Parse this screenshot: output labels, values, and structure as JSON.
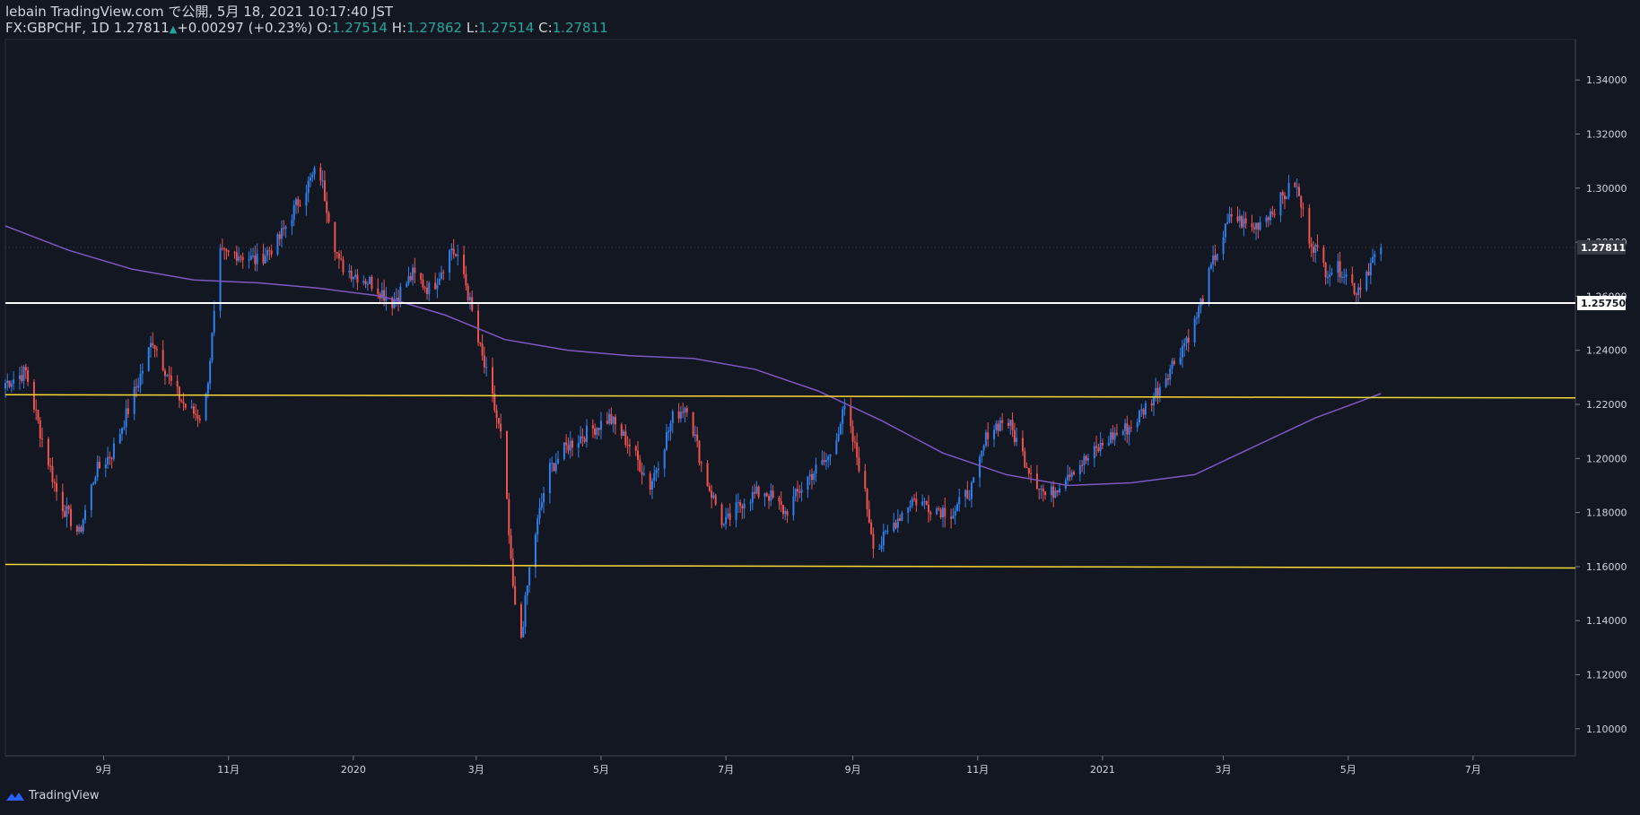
{
  "header": {
    "line1": "lebain TradingView.com で公開, 5月 18, 2021 10:17:40 JST",
    "symbol": "FX:GBPCHF, 1D",
    "last": "1.27811",
    "change": "+0.00297 (+0.23%)",
    "o_label": "O:",
    "o_value": "1.27514",
    "h_label": "H:",
    "h_value": "1.27862",
    "l_label": "L:",
    "l_value": "1.27514",
    "c_label": "C:",
    "c_value": "1.27811"
  },
  "footer": {
    "brand": "TradingView"
  },
  "colors": {
    "background": "#131722",
    "up": "#2f80ed",
    "down": "#ef5350",
    "ma": "#7e57c2",
    "support": "#fdd835",
    "level": "#ffffff",
    "text": "#d1d4dc"
  },
  "chart_data": {
    "type": "line",
    "symbol": "FX:GBPCHF",
    "interval": "1D",
    "yaxis": {
      "ylim": [
        1.09,
        1.355
      ],
      "ticks": [
        "1.10000",
        "1.12000",
        "1.14000",
        "1.16000",
        "1.18000",
        "1.20000",
        "1.22000",
        "1.24000",
        "1.26000",
        "1.28000",
        "1.30000",
        "1.32000",
        "1.34000"
      ],
      "side": "right"
    },
    "xaxis": {
      "ticks": [
        {
          "label": "9月",
          "x": "2019-09-01"
        },
        {
          "label": "11月",
          "x": "2019-11-01"
        },
        {
          "label": "2020",
          "x": "2020-01-01"
        },
        {
          "label": "3月",
          "x": "2020-03-01"
        },
        {
          "label": "5月",
          "x": "2020-05-01"
        },
        {
          "label": "7月",
          "x": "2020-07-01"
        },
        {
          "label": "9月",
          "x": "2020-09-01"
        },
        {
          "label": "11月",
          "x": "2020-11-01"
        },
        {
          "label": "2021",
          "x": "2021-01-01"
        },
        {
          "label": "3月",
          "x": "2021-03-01"
        },
        {
          "label": "5月",
          "x": "2021-05-01"
        },
        {
          "label": "7月",
          "x": "2021-07-01"
        }
      ],
      "xlim": [
        "2019-07-15",
        "2021-08-20"
      ]
    },
    "grid": false,
    "series": [
      {
        "kind": "price",
        "style": "candlestick-approx",
        "x": [
          "2019-07-15",
          "2019-07-25",
          "2019-08-01",
          "2019-08-10",
          "2019-08-20",
          "2019-08-28",
          "2019-09-05",
          "2019-09-15",
          "2019-09-25",
          "2019-10-05",
          "2019-10-12",
          "2019-10-20",
          "2019-10-28",
          "2019-11-05",
          "2019-11-15",
          "2019-11-25",
          "2019-12-05",
          "2019-12-15",
          "2019-12-25",
          "2020-01-02",
          "2020-01-10",
          "2020-01-20",
          "2020-01-30",
          "2020-02-08",
          "2020-02-18",
          "2020-02-24",
          "2020-03-02",
          "2020-03-08",
          "2020-03-14",
          "2020-03-18",
          "2020-03-22",
          "2020-03-28",
          "2020-04-05",
          "2020-04-15",
          "2020-04-25",
          "2020-05-05",
          "2020-05-15",
          "2020-05-25",
          "2020-06-05",
          "2020-06-12",
          "2020-06-20",
          "2020-06-30",
          "2020-07-10",
          "2020-07-20",
          "2020-07-30",
          "2020-08-10",
          "2020-08-20",
          "2020-08-28",
          "2020-09-05",
          "2020-09-12",
          "2020-09-20",
          "2020-09-30",
          "2020-10-10",
          "2020-10-20",
          "2020-10-30",
          "2020-11-06",
          "2020-11-15",
          "2020-11-25",
          "2020-12-05",
          "2020-12-15",
          "2020-12-25",
          "2021-01-05",
          "2021-01-15",
          "2021-01-25",
          "2021-02-05",
          "2021-02-15",
          "2021-02-25",
          "2021-03-05",
          "2021-03-15",
          "2021-03-25",
          "2021-04-05",
          "2021-04-12",
          "2021-04-20",
          "2021-04-28",
          "2021-05-05",
          "2021-05-12",
          "2021-05-17"
        ],
        "values": [
          1.228,
          1.232,
          1.21,
          1.185,
          1.172,
          1.195,
          1.202,
          1.222,
          1.244,
          1.226,
          1.218,
          1.215,
          1.275,
          1.276,
          1.273,
          1.28,
          1.295,
          1.308,
          1.272,
          1.268,
          1.265,
          1.258,
          1.268,
          1.262,
          1.278,
          1.268,
          1.243,
          1.225,
          1.205,
          1.16,
          1.128,
          1.165,
          1.195,
          1.205,
          1.21,
          1.215,
          1.205,
          1.19,
          1.215,
          1.22,
          1.195,
          1.175,
          1.185,
          1.188,
          1.18,
          1.193,
          1.2,
          1.218,
          1.195,
          1.165,
          1.175,
          1.185,
          1.182,
          1.18,
          1.19,
          1.21,
          1.215,
          1.198,
          1.185,
          1.195,
          1.2,
          1.208,
          1.212,
          1.222,
          1.236,
          1.25,
          1.275,
          1.29,
          1.285,
          1.292,
          1.302,
          1.282,
          1.27,
          1.27,
          1.262,
          1.272,
          1.278
        ]
      },
      {
        "kind": "moving-average",
        "x": [
          "2019-07-15",
          "2019-08-15",
          "2019-09-15",
          "2019-10-15",
          "2019-11-15",
          "2019-12-15",
          "2020-01-15",
          "2020-02-15",
          "2020-03-15",
          "2020-04-15",
          "2020-05-15",
          "2020-06-15",
          "2020-07-15",
          "2020-08-15",
          "2020-09-15",
          "2020-10-15",
          "2020-11-15",
          "2020-12-15",
          "2021-01-15",
          "2021-02-15",
          "2021-03-15",
          "2021-04-15",
          "2021-05-17"
        ],
        "values": [
          1.286,
          1.277,
          1.27,
          1.266,
          1.265,
          1.263,
          1.26,
          1.253,
          1.244,
          1.24,
          1.238,
          1.237,
          1.233,
          1.225,
          1.214,
          1.202,
          1.194,
          1.19,
          1.191,
          1.194,
          1.204,
          1.215,
          1.224
        ]
      },
      {
        "kind": "horizontal-level",
        "x": [
          "2019-07-15",
          "2021-08-20"
        ],
        "values": [
          1.2575,
          1.2575
        ],
        "axis_label": "1.25750"
      },
      {
        "kind": "trendline",
        "x": [
          "2019-07-15",
          "2021-08-20"
        ],
        "values": [
          1.2236,
          1.2224
        ]
      },
      {
        "kind": "trendline",
        "x": [
          "2019-07-15",
          "2021-08-20"
        ],
        "values": [
          1.1608,
          1.1595
        ]
      }
    ],
    "price_tag": "1.27811",
    "last_value": 1.27811
  }
}
